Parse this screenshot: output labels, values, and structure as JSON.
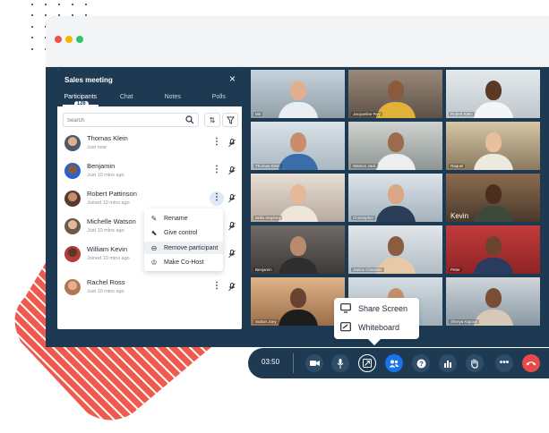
{
  "panel": {
    "title": "Sales meeting",
    "close_icon": "×",
    "tabs": [
      {
        "label": "Participants",
        "badge": "126"
      },
      {
        "label": "Chat"
      },
      {
        "label": "Notes"
      },
      {
        "label": "Polls"
      }
    ],
    "search": {
      "placeholder": "Search"
    },
    "participants": [
      {
        "name": "Thomas Klein",
        "status": "Just now"
      },
      {
        "name": "Benjamin",
        "status": "Just 10 mins ago"
      },
      {
        "name": "Robert Pattinson",
        "status": "Joined 10 mins ago"
      },
      {
        "name": "Michelle Watson",
        "status": "Just 10 mins ago"
      },
      {
        "name": "William Kevin",
        "status": "Joined 10 mins ago"
      },
      {
        "name": "Rachel Ross",
        "status": "Just 10 mins ago"
      }
    ],
    "context_menu": [
      {
        "label": "Rename",
        "icon": "pencil-icon"
      },
      {
        "label": "Give control",
        "icon": "cursor-icon"
      },
      {
        "label": "Remove participant",
        "icon": "minus-circle-icon"
      },
      {
        "label": "Make Co-Host",
        "icon": "crown-icon"
      }
    ]
  },
  "grid": {
    "tiles": [
      {
        "label": "Me"
      },
      {
        "label": "Jacqueline Roy"
      },
      {
        "label": "Robert Klein"
      },
      {
        "label": "Thomas Klein"
      },
      {
        "label": "Watson Jack"
      },
      {
        "label": "Raquel"
      },
      {
        "label": "Bella Stephen"
      },
      {
        "label": "Christopher"
      },
      {
        "label": "Kevin"
      },
      {
        "label": "Benjamin"
      },
      {
        "label": "Janice Chandler"
      },
      {
        "label": "Peter"
      },
      {
        "label": "Sutton Joey"
      },
      {
        "label": ""
      },
      {
        "label": "Shreya Kapoor"
      }
    ]
  },
  "share_popup": {
    "items": [
      {
        "label": "Share Screen",
        "icon": "monitor-icon"
      },
      {
        "label": "Whiteboard",
        "icon": "whiteboard-icon"
      }
    ]
  },
  "controls": {
    "timer": "03:50",
    "colors": {
      "accent": "#1a73e8",
      "end": "#e84a4a",
      "bar": "#1d3a52"
    }
  }
}
